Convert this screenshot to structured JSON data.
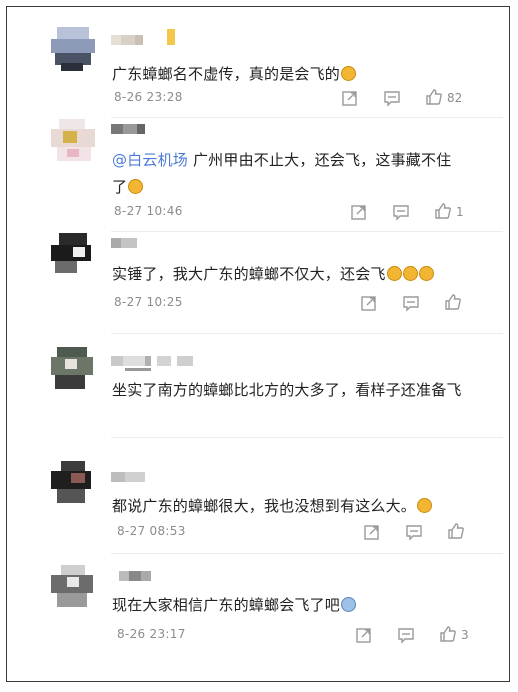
{
  "comments": [
    {
      "text": "广东蟑螂名不虚传，真的是会飞的",
      "emojis": [
        "laughing-face"
      ],
      "time": "8-26 23:28",
      "like_count": "82"
    },
    {
      "mention": "@白云机场",
      "text": " 广州甲由不止大，还会飞，这事藏不住了",
      "emojis": [
        "crying-laughing-face"
      ],
      "time": "8-27 10:46",
      "like_count": "1"
    },
    {
      "text": "实锤了，我大广东的蟑螂不仅大，还会飞",
      "emojis": [
        "crying-laughing-face",
        "crying-laughing-face",
        "crying-laughing-face"
      ],
      "time": "8-27 10:25",
      "like_count": ""
    },
    {
      "text": "坐实了南方的蟑螂比北方的大多了，看样子还准备飞",
      "emojis": [],
      "time": "",
      "like_count": ""
    },
    {
      "text": "都说广东的蟑螂很大，我也没想到有这么大。",
      "emojis": [
        "cat-face"
      ],
      "time": "8-27 08:53",
      "like_count": ""
    },
    {
      "text": "现在大家相信广东的蟑螂会飞了吧",
      "emojis": [
        "shocked-face"
      ],
      "time": "8-26 23:17",
      "like_count": "3"
    }
  ],
  "icons": {
    "share": "share-icon",
    "reply": "comment-icon",
    "like": "thumbs-up-icon"
  },
  "colors": {
    "mention": "#4b7bd8",
    "meta": "#8c8c8c",
    "text": "#222222"
  }
}
